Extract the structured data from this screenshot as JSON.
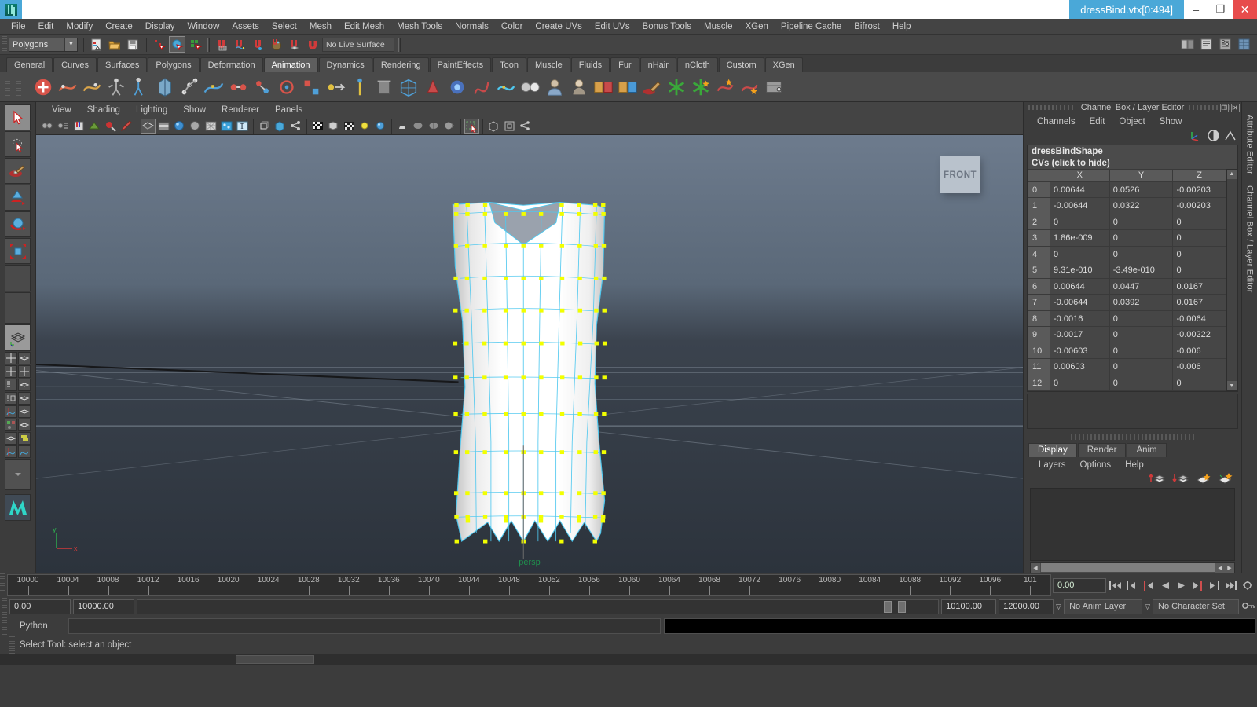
{
  "window": {
    "title": "dressBind.vtx[0:494]",
    "app_icon": "maya-logo-icon",
    "minimize": "–",
    "restore": "❐",
    "close": "✕"
  },
  "menubar": [
    "File",
    "Edit",
    "Modify",
    "Create",
    "Display",
    "Window",
    "Assets",
    "Select",
    "Mesh",
    "Edit Mesh",
    "Mesh Tools",
    "Normals",
    "Color",
    "Create UVs",
    "Edit UVs",
    "Bonus Tools",
    "Muscle",
    "XGen",
    "Pipeline Cache",
    "Bifrost",
    "Help"
  ],
  "statusline": {
    "selection_mode": "Polygons",
    "live_surface": "No Live Surface"
  },
  "shelf": {
    "tabs": [
      "General",
      "Curves",
      "Surfaces",
      "Polygons",
      "Deformation",
      "Animation",
      "Dynamics",
      "Rendering",
      "PaintEffects",
      "Toon",
      "Muscle",
      "Fluids",
      "Fur",
      "nHair",
      "nCloth",
      "Custom",
      "XGen"
    ],
    "active_tab": "Animation"
  },
  "viewport": {
    "menus": [
      "View",
      "Shading",
      "Lighting",
      "Show",
      "Renderer",
      "Panels"
    ],
    "view_cube_label": "FRONT",
    "camera_label": "persp",
    "axis_x": "x",
    "axis_y": "y"
  },
  "channelbox": {
    "dock_title": "Channel Box / Layer Editor",
    "menus": [
      "Channels",
      "Edit",
      "Object",
      "Show"
    ],
    "object_name": "dressBindShape",
    "subtitle": "CVs (click to hide)",
    "columns": [
      "",
      "X",
      "Y",
      "Z"
    ],
    "rows": [
      {
        "idx": "0",
        "x": "0.00644",
        "y": "0.0526",
        "z": "-0.00203"
      },
      {
        "idx": "1",
        "x": "-0.00644",
        "y": "0.0322",
        "z": "-0.00203"
      },
      {
        "idx": "2",
        "x": "0",
        "y": "0",
        "z": "0"
      },
      {
        "idx": "3",
        "x": "1.86e-009",
        "y": "0",
        "z": "0"
      },
      {
        "idx": "4",
        "x": "0",
        "y": "0",
        "z": "0"
      },
      {
        "idx": "5",
        "x": "9.31e-010",
        "y": "-3.49e-010",
        "z": "0"
      },
      {
        "idx": "6",
        "x": "0.00644",
        "y": "0.0447",
        "z": "0.0167"
      },
      {
        "idx": "7",
        "x": "-0.00644",
        "y": "0.0392",
        "z": "0.0167"
      },
      {
        "idx": "8",
        "x": "-0.0016",
        "y": "0",
        "z": "-0.0064"
      },
      {
        "idx": "9",
        "x": "-0.0017",
        "y": "0",
        "z": "-0.00222"
      },
      {
        "idx": "10",
        "x": "-0.00603",
        "y": "0",
        "z": "-0.006"
      },
      {
        "idx": "11",
        "x": "0.00603",
        "y": "0",
        "z": "-0.006"
      },
      {
        "idx": "12",
        "x": "0",
        "y": "0",
        "z": "0"
      }
    ]
  },
  "layereditor": {
    "tabs": [
      "Display",
      "Render",
      "Anim"
    ],
    "active_tab": "Display",
    "menus": [
      "Layers",
      "Options",
      "Help"
    ]
  },
  "vertical_tabs": [
    "Attribute Editor",
    "Channel Box / Layer Editor"
  ],
  "timeline": {
    "ticks": [
      "10000",
      "10004",
      "10008",
      "10012",
      "10016",
      "10020",
      "10024",
      "10028",
      "10032",
      "10036",
      "10040",
      "10044",
      "10048",
      "10052",
      "10056",
      "10060",
      "10064",
      "10068",
      "10072",
      "10076",
      "10080",
      "10084",
      "10088",
      "10092",
      "10096",
      "101"
    ],
    "current_frame": "0.00",
    "playback_buttons": [
      "go-to-start",
      "step-back-key",
      "step-back-frame",
      "play-backwards",
      "play-forwards",
      "step-forward-frame",
      "step-forward-key"
    ]
  },
  "range": {
    "start": "0.00",
    "end": "10000.00",
    "playback_start": "10100.00",
    "playback_end": "12000.00",
    "anim_layer": "No Anim Layer",
    "character_set": "No Character Set"
  },
  "commandline": {
    "language": "Python",
    "input_value": "",
    "output_value": ""
  },
  "statusbar": {
    "help_text": "Select Tool: select an object"
  },
  "colors": {
    "title_accent": "#4aa8d8",
    "close_red": "#e74c4c",
    "panel_bg": "#3c3c3c",
    "mesh_wire": "#3fc8f0",
    "cv_yellow": "#e8ff00",
    "camera_green": "#1f8f4d"
  }
}
